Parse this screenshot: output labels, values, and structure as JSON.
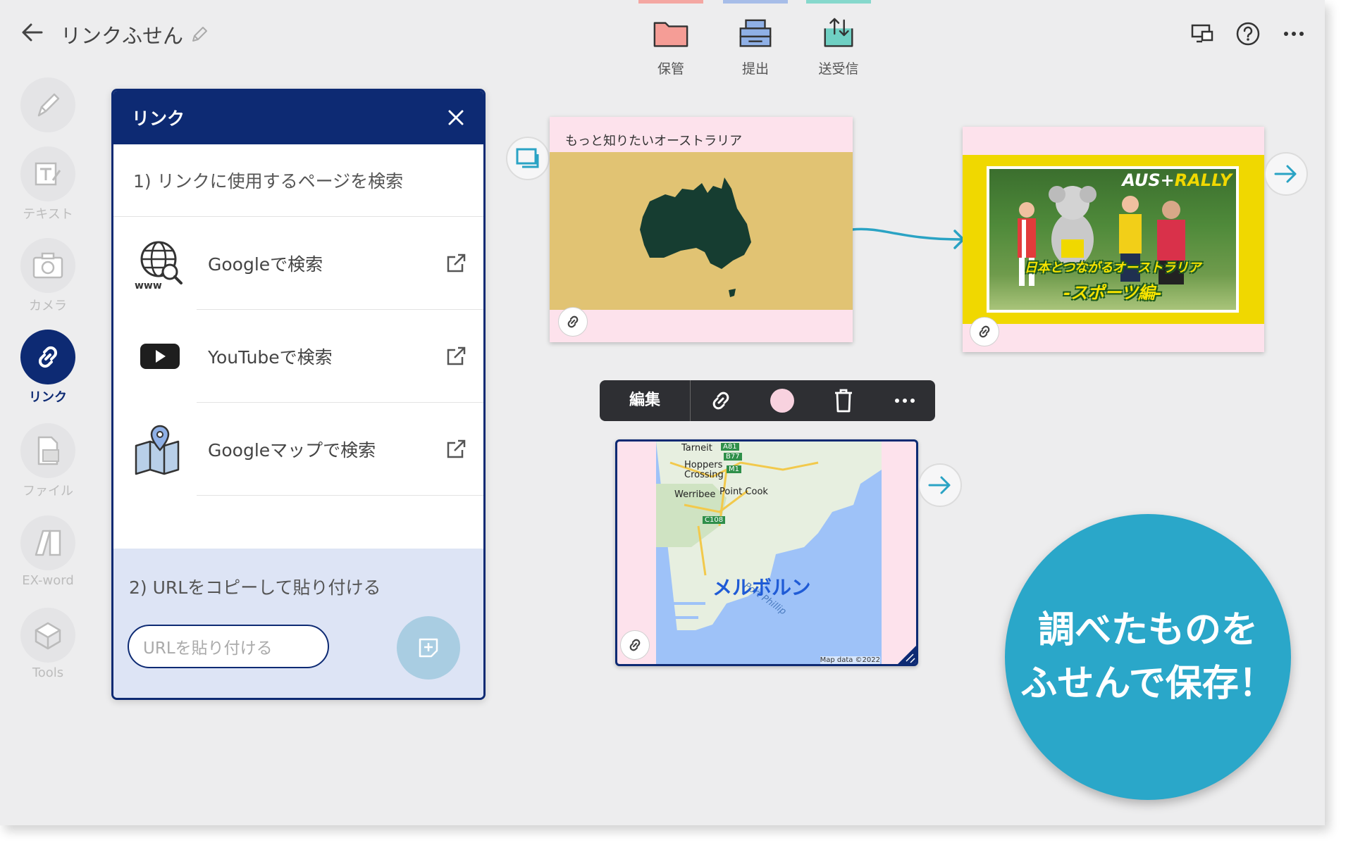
{
  "header": {
    "title": "リンクふせん",
    "toolbar": [
      {
        "label": "保管",
        "icon": "folder-icon",
        "color": "#f4a7a2"
      },
      {
        "label": "提出",
        "icon": "submit-tray-icon",
        "color": "#a7bde8"
      },
      {
        "label": "送受信",
        "icon": "send-receive-icon",
        "color": "#86d8cc"
      }
    ]
  },
  "rail": {
    "items": [
      {
        "label": "",
        "icon": "pen-icon"
      },
      {
        "label": "テキスト",
        "icon": "text-icon"
      },
      {
        "label": "カメラ",
        "icon": "camera-icon"
      },
      {
        "label": "リンク",
        "icon": "link-icon",
        "active": true
      },
      {
        "label": "ファイル",
        "icon": "file-icon"
      },
      {
        "label": "EX-word",
        "icon": "dictionary-icon"
      },
      {
        "label": "Tools",
        "icon": "tools-box-icon"
      }
    ]
  },
  "panel": {
    "title": "リンク",
    "step1": "1) リンクに使用するページを検索",
    "options": [
      {
        "label": "Googleで検索",
        "icon": "web-search-icon"
      },
      {
        "label": "YouTubeで検索",
        "icon": "youtube-icon"
      },
      {
        "label": "Googleマップで検索",
        "icon": "map-pin-icon"
      }
    ],
    "step2": "2) URLをコピーして貼り付ける",
    "url_placeholder": "URLを貼り付ける"
  },
  "cards": {
    "australia": {
      "caption": "もっと知りたいオーストラリア",
      "bg": "#e1c373"
    },
    "video": {
      "logo_a": "AUS",
      "logo_plus": "+",
      "logo_b": "RALLY",
      "line1": "日本とつながるオーストラリア",
      "line2": "-スポーツ編-"
    },
    "map": {
      "city": "メルボルン",
      "places": [
        "Tarneit",
        "Hoppers",
        "Crossing",
        "Werribee",
        "Point Cook",
        "Port Phillip"
      ],
      "roads": [
        "A81",
        "B77",
        "M1",
        "C108"
      ],
      "credit": "Map data ©2022"
    }
  },
  "context_toolbar": {
    "edit": "編集",
    "color": "#f8d2df"
  },
  "promo": {
    "line1": "調べたものを",
    "line2": "ふせんで保存！"
  }
}
